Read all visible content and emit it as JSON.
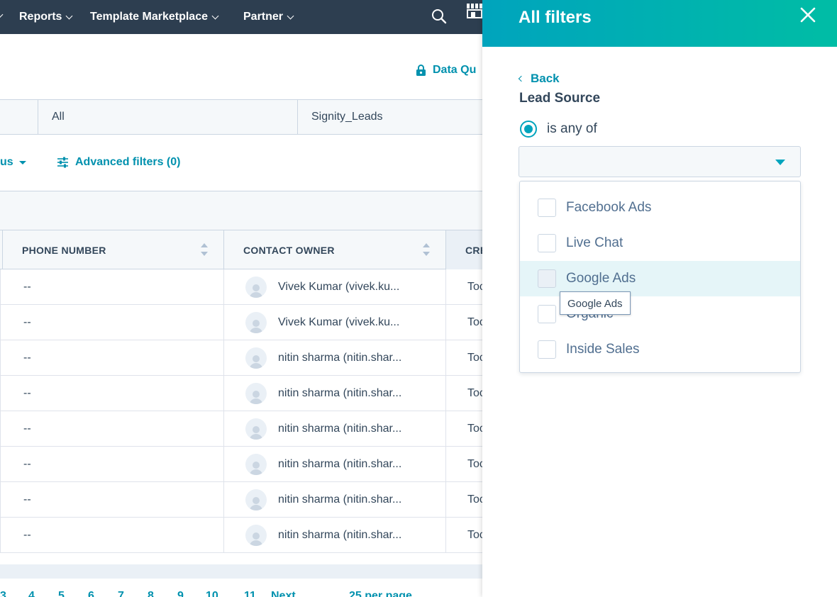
{
  "nav": {
    "items": [
      {
        "label": "Reports"
      },
      {
        "label": "Template Marketplace"
      },
      {
        "label": "Partner"
      }
    ]
  },
  "main": {
    "data_quality_label": "Data Qu",
    "views": [
      {
        "label": "All"
      },
      {
        "label": "Signity_Leads"
      }
    ],
    "status_fragment": "us",
    "advanced_filters_label": "Advanced filters (0)",
    "table": {
      "headers": [
        "PHONE NUMBER",
        "CONTACT OWNER",
        "CRE"
      ],
      "rows": [
        {
          "phone": "--",
          "owner": "Vivek Kumar (vivek.ku...",
          "created": "Toc"
        },
        {
          "phone": "--",
          "owner": "Vivek Kumar (vivek.ku...",
          "created": "Toc"
        },
        {
          "phone": "--",
          "owner": "nitin sharma (nitin.shar...",
          "created": "Toc"
        },
        {
          "phone": "--",
          "owner": "nitin sharma (nitin.shar...",
          "created": "Toc"
        },
        {
          "phone": "--",
          "owner": "nitin sharma (nitin.shar...",
          "created": "Toc"
        },
        {
          "phone": "--",
          "owner": "nitin sharma (nitin.shar...",
          "created": "Toc"
        },
        {
          "phone": "--",
          "owner": "nitin sharma (nitin.shar...",
          "created": "Toc"
        },
        {
          "phone": "--",
          "owner": "nitin sharma (nitin.shar...",
          "created": "Toc"
        }
      ]
    },
    "pagination": {
      "pages": [
        "3",
        "4",
        "5",
        "6",
        "7",
        "8",
        "9",
        "10",
        "11"
      ],
      "next_label": "Next",
      "per_page_label": "25 per page"
    }
  },
  "panel": {
    "title": "All filters",
    "back_label": "Back",
    "property_label": "Lead Source",
    "operator_label": "is any of",
    "options": [
      {
        "label": "Facebook Ads"
      },
      {
        "label": "Live Chat"
      },
      {
        "label": "Google Ads"
      },
      {
        "label": "Organic"
      },
      {
        "label": "Inside Sales"
      }
    ],
    "tooltip": "Google Ads"
  },
  "icons": {
    "search": "search-icon",
    "marketplace": "marketplace-icon",
    "lock": "lock-icon",
    "filter": "filter-sliders-icon",
    "close": "close-icon"
  },
  "colors": {
    "nav_bg": "#2d3e50",
    "accent": "#0091ae",
    "header_gradient_start": "#00a4bd",
    "header_gradient_end": "#00bda5",
    "hover_row": "#e5f5f8"
  }
}
